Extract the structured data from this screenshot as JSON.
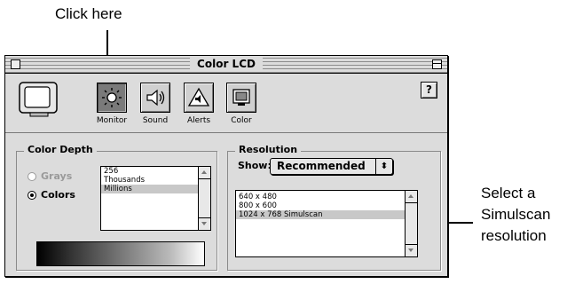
{
  "callouts": {
    "top": "Click here",
    "right_lines": [
      "Select a",
      "Simulscan",
      "resolution"
    ]
  },
  "window": {
    "title": "Color LCD"
  },
  "toolbar": {
    "items": [
      {
        "label": "Monitor",
        "icon": "monitor-icon",
        "selected": true
      },
      {
        "label": "Sound",
        "icon": "speaker-icon",
        "selected": false
      },
      {
        "label": "Alerts",
        "icon": "alert-triangle-icon",
        "selected": false
      },
      {
        "label": "Color",
        "icon": "color-icon",
        "selected": false
      }
    ],
    "help_label": "?"
  },
  "color_depth": {
    "title": "Color Depth",
    "options": [
      {
        "label": "Grays",
        "selected": false,
        "enabled": false
      },
      {
        "label": "Colors",
        "selected": true,
        "enabled": true
      }
    ],
    "list": [
      "256",
      "Thousands",
      "Millions"
    ],
    "selected_index": 2
  },
  "resolution": {
    "title": "Resolution",
    "show_label": "Show:",
    "show_value": "Recommended",
    "list": [
      "640 x 480",
      "800 x 600",
      "1024 x 768  Simulscan"
    ],
    "selected_index": 2
  },
  "colors": {
    "window_bg": "#dcdcdc",
    "selection": "#c8c8c8"
  }
}
